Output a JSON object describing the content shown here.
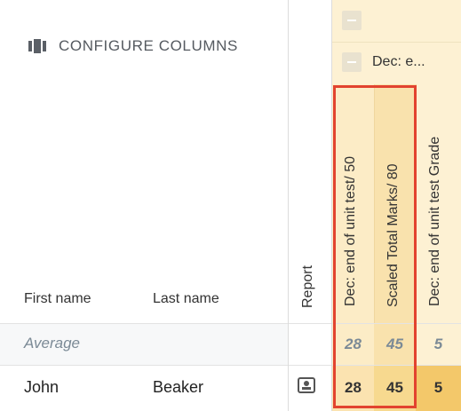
{
  "toolbar": {
    "configure_label": "CONFIGURE COLUMNS"
  },
  "table": {
    "headers": {
      "first_name": "First name",
      "last_name": "Last name",
      "report": "Report"
    },
    "group": {
      "label": "Dec: e..."
    },
    "columns": [
      {
        "label": "Dec: end of unit test/ 50"
      },
      {
        "label": "Scaled Total Marks/ 80"
      },
      {
        "label": "Dec: end of unit test Grade"
      }
    ],
    "average_row": {
      "label": "Average",
      "values": [
        "28",
        "45",
        "5"
      ]
    },
    "rows": [
      {
        "first_name": "John",
        "last_name": "Beaker",
        "values": [
          "28",
          "45",
          "5"
        ]
      }
    ]
  },
  "colors": {
    "highlight_border": "#e2432f",
    "column_yellow": "#fbe8bf",
    "column_yellow_light": "#fdf1d3",
    "cell_yellow_dark": "#f7d98f"
  }
}
